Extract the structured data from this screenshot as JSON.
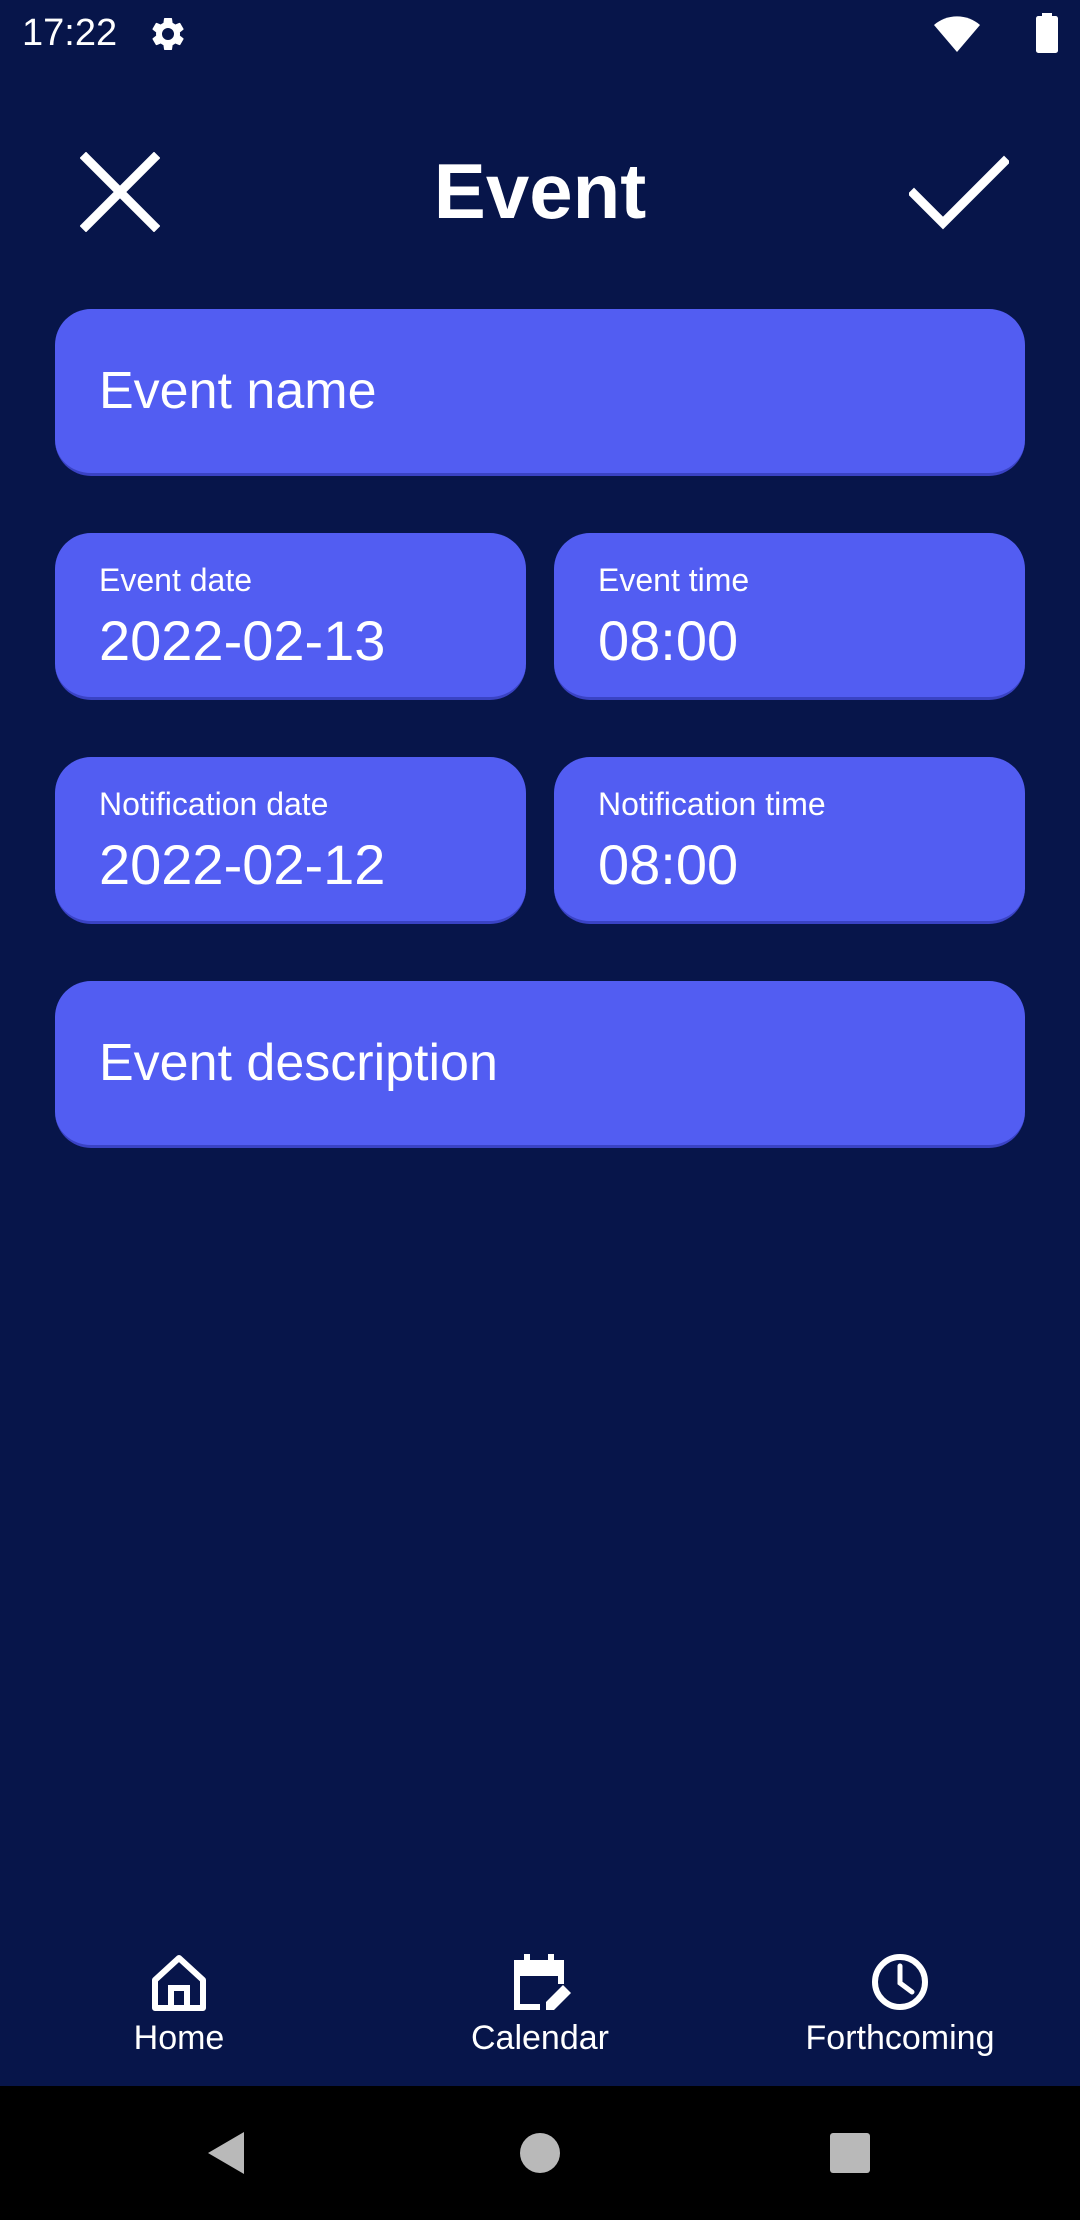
{
  "status_bar": {
    "time": "17:22"
  },
  "app_bar": {
    "title": "Event",
    "close_icon": "close-icon",
    "confirm_icon": "check-icon"
  },
  "form": {
    "event_name": {
      "placeholder": "Event name"
    },
    "event_date": {
      "label": "Event date",
      "value": "2022-02-13"
    },
    "event_time": {
      "label": "Event time",
      "value": "08:00"
    },
    "notification_date": {
      "label": "Notification date",
      "value": "2022-02-12"
    },
    "notification_time": {
      "label": "Notification time",
      "value": "08:00"
    },
    "event_description": {
      "placeholder": "Event description"
    }
  },
  "bottom_nav": {
    "items": [
      {
        "label": "Home",
        "icon": "home-icon"
      },
      {
        "label": "Calendar",
        "icon": "calendar-edit-icon"
      },
      {
        "label": "Forthcoming",
        "icon": "clock-icon"
      }
    ]
  },
  "colors": {
    "background": "#07154a",
    "field": "#525df2",
    "text": "#ffffff",
    "system_nav": "#000000"
  }
}
